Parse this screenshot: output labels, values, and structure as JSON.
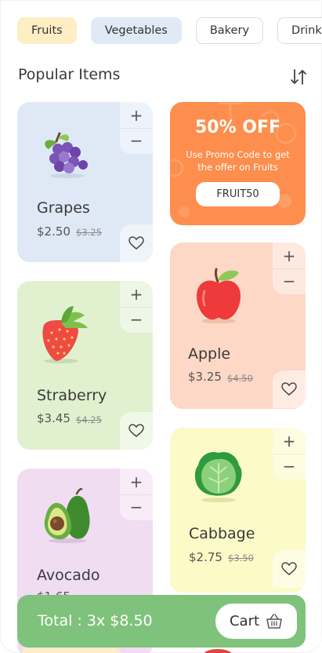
{
  "categories": [
    {
      "label": "Fruits",
      "active": true
    },
    {
      "label": "Vegetables"
    },
    {
      "label": "Bakery"
    },
    {
      "label": "Drinks"
    }
  ],
  "section": {
    "title": "Popular Items"
  },
  "promo": {
    "headline": "50% OFF",
    "subtitle": "Use Promo Code to get the offer on Fruits",
    "code": "FRUIT50"
  },
  "products": {
    "grapes": {
      "name": "Grapes",
      "price": "$2.50",
      "old_price": "$3.25"
    },
    "strawberry": {
      "name": "Straberry",
      "price": "$3.45",
      "old_price": "$4.25"
    },
    "avocado": {
      "name": "Avocado",
      "price": "$1.65"
    },
    "apple": {
      "name": "Apple",
      "price": "$3.25",
      "old_price": "$4.50"
    },
    "cabbage": {
      "name": "Cabbage",
      "price": "$2.75",
      "old_price": "$3.50"
    }
  },
  "stepper": {
    "plus": "+",
    "minus": "−"
  },
  "cart": {
    "total": "Total : 3x $8.50",
    "button_label": "Cart"
  },
  "colors": {
    "accent_green": "#7fc27b",
    "promo_orange": "#fd8e4d",
    "grapes_bg": "#dfe9f6",
    "strawberry_bg": "#e1f1cf",
    "avocado_bg": "#f0ddf2",
    "apple_bg": "#fdd8c6",
    "cabbage_bg": "#fcfac7"
  },
  "icons": [
    "sort-icon",
    "plus-icon",
    "minus-icon",
    "heart-icon",
    "basket-icon"
  ]
}
